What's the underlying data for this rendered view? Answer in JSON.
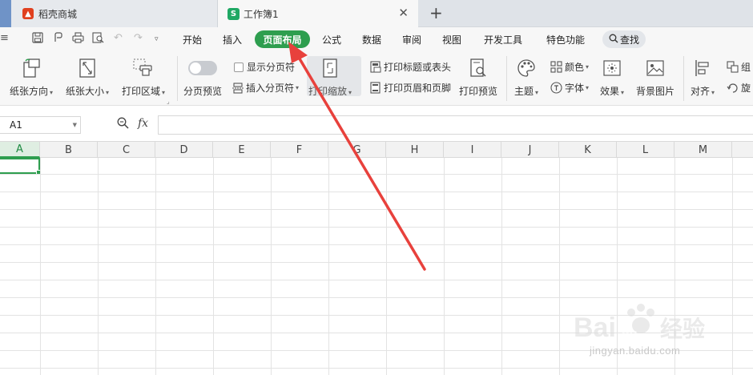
{
  "tabs": {
    "store": "稻壳商城",
    "book": "工作簿1",
    "book_logo": "S",
    "close_glyph": "✕",
    "add_glyph": "+"
  },
  "menu": {
    "items": [
      "开始",
      "插入",
      "页面布局",
      "公式",
      "数据",
      "审阅",
      "视图",
      "开发工具",
      "特色功能"
    ],
    "active": "页面布局",
    "search": "查找"
  },
  "ribbon": {
    "orientation": "纸张方向",
    "paper_size": "纸张大小",
    "print_area": "打印区域",
    "page_break_preview": "分页预览",
    "show_page_break": "显示分页符",
    "insert_page_break": "插入分页符",
    "print_scale": "打印缩放",
    "print_titles": "打印标题或表头",
    "print_header_footer": "打印页眉和页脚",
    "print_preview": "打印预览",
    "theme": "主题",
    "colors": "颜色",
    "fonts": "字体",
    "effects": "效果",
    "background_image": "背景图片",
    "align": "对齐",
    "group": "组",
    "rotate": "旋"
  },
  "formula_bar": {
    "cell_ref": "A1",
    "fx": "fx"
  },
  "columns": [
    "A",
    "B",
    "C",
    "D",
    "E",
    "F",
    "G",
    "H",
    "I",
    "J",
    "K",
    "L",
    "M"
  ],
  "selected_column": "A",
  "watermark": {
    "brand": "Bai du 经验",
    "url": "jingyan.baidu.com"
  },
  "colors": {
    "accent": "#2e9e4f",
    "annotation_arrow": "#e8413c"
  }
}
